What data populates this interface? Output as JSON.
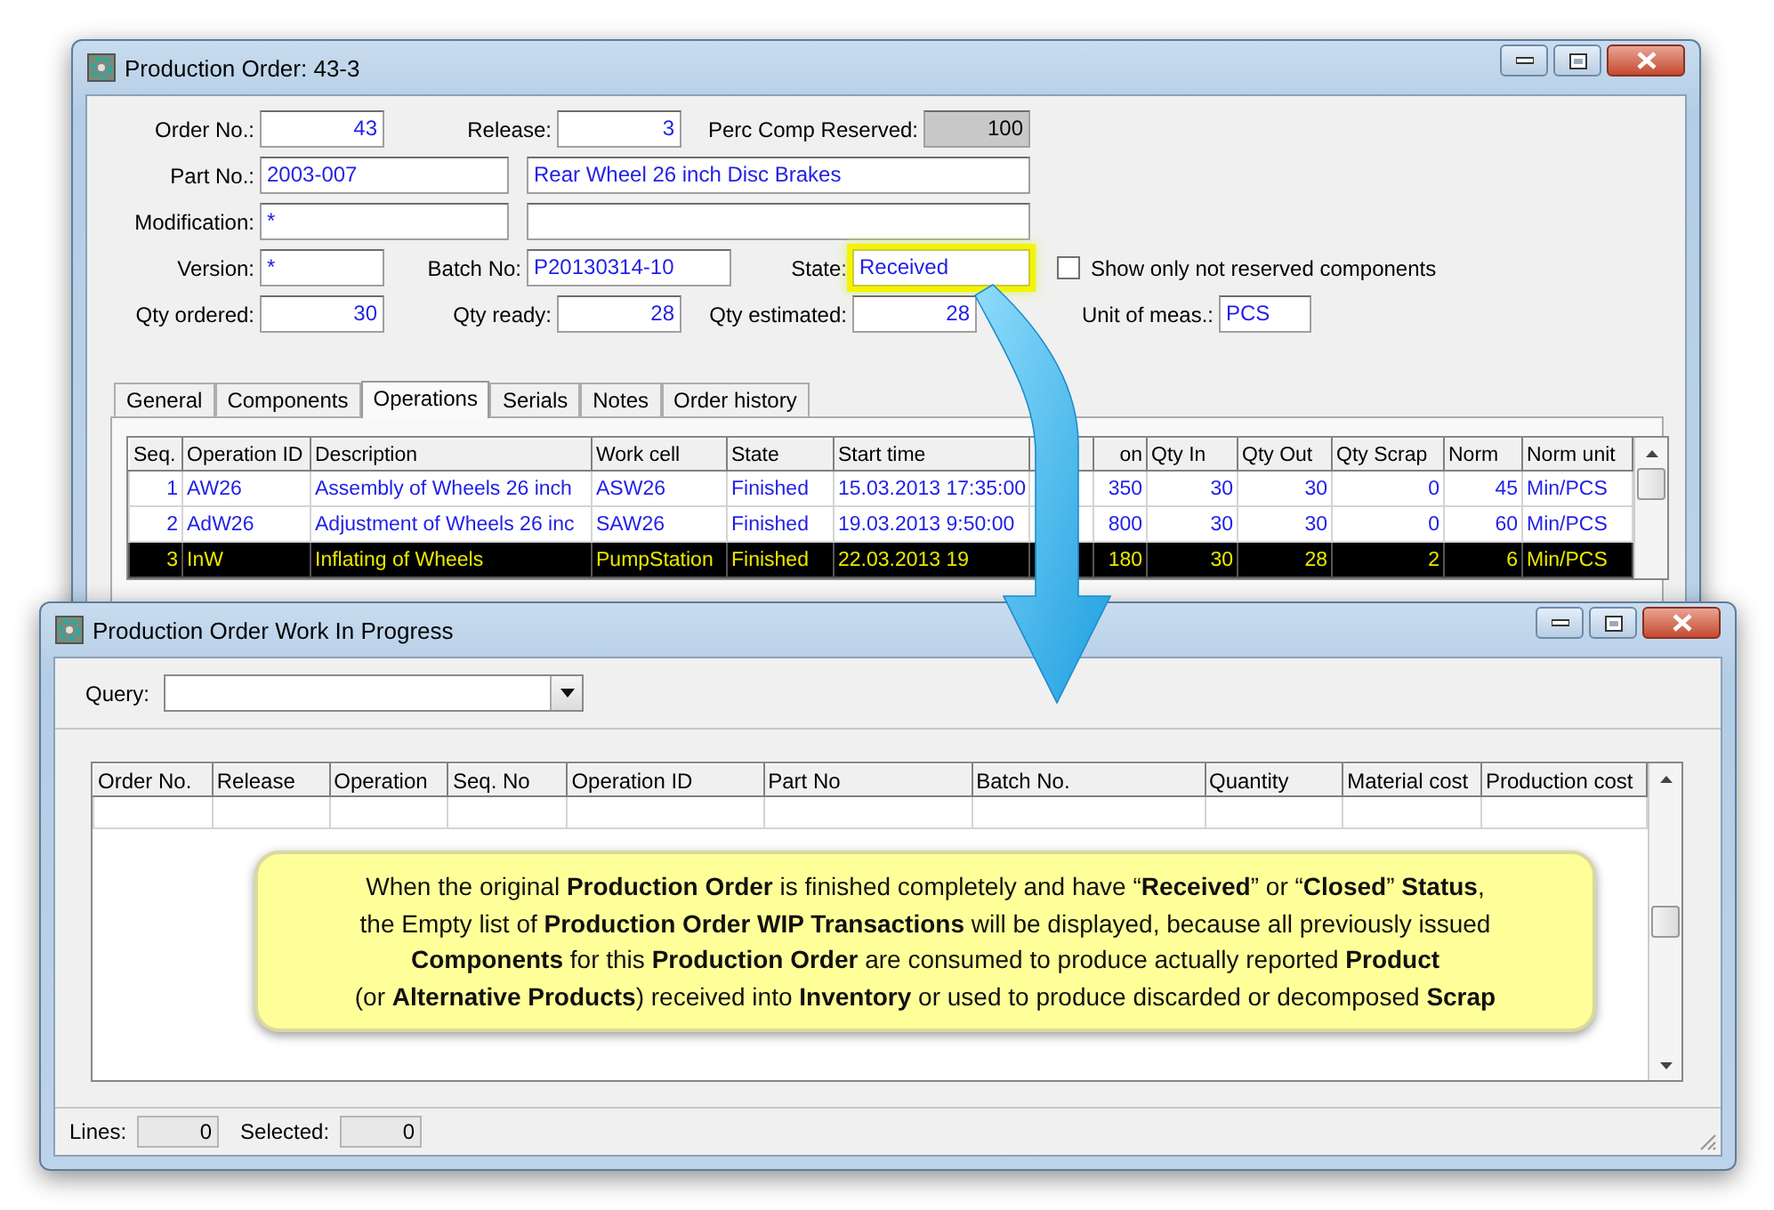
{
  "order_window": {
    "title": "Production Order: 43-3",
    "form_rows": [
      [
        {
          "kind": "label",
          "text": "Order No.:"
        },
        {
          "kind": "number_field",
          "value": "43",
          "disabled": false,
          "highlighted": false
        },
        {
          "kind": "label",
          "text": "Release:"
        },
        {
          "kind": "number_field",
          "value": "3",
          "disabled": false,
          "highlighted": false
        },
        {
          "kind": "label",
          "text": "Perc Comp Reserved:"
        },
        {
          "kind": "number_field",
          "value": "100",
          "disabled": true,
          "highlighted": false
        }
      ],
      [
        {
          "kind": "label",
          "text": "Part No.:"
        },
        {
          "kind": "text_field",
          "value": "2003-007",
          "disabled": false,
          "highlighted": false
        },
        {
          "kind": "text_field",
          "value": "Rear Wheel 26 inch Disc Brakes",
          "disabled": false,
          "highlighted": false
        }
      ],
      [
        {
          "kind": "label",
          "text": "Modification:"
        },
        {
          "kind": "text_field",
          "value": "*",
          "disabled": false,
          "highlighted": false
        },
        {
          "kind": "text_field",
          "disabled": false,
          "highlighted": false
        }
      ],
      [
        {
          "kind": "label",
          "text": "Version:"
        },
        {
          "kind": "text_field",
          "value": "*",
          "disabled": false,
          "highlighted": false
        },
        {
          "kind": "label",
          "text": "Batch No:"
        },
        {
          "kind": "text_field",
          "value": "P20130314-10",
          "disabled": false,
          "highlighted": false
        },
        {
          "kind": "label",
          "text": "State:"
        },
        {
          "kind": "text_field",
          "value": "Received",
          "disabled": false,
          "highlighted": true
        },
        {
          "kind": "checkbox",
          "label": "Show only not reserved components",
          "checked": false
        }
      ],
      [
        {
          "kind": "label",
          "text": "Qty ordered:"
        },
        {
          "kind": "number_field",
          "value": "30",
          "disabled": false,
          "highlighted": false
        },
        {
          "kind": "label",
          "text": "Qty ready:"
        },
        {
          "kind": "number_field",
          "value": "28",
          "disabled": false,
          "highlighted": false
        },
        {
          "kind": "label",
          "text": "Qty estimated:"
        },
        {
          "kind": "number_field",
          "value": "28",
          "disabled": false,
          "highlighted": false
        },
        {
          "kind": "label",
          "text": "Unit of meas.:"
        },
        {
          "kind": "text_field",
          "value": "PCS",
          "disabled": false,
          "highlighted": false
        }
      ]
    ],
    "tabs": [
      {
        "label": "General",
        "selected": false
      },
      {
        "label": "Components",
        "selected": false
      },
      {
        "label": "Operations",
        "selected": true
      },
      {
        "label": "Serials",
        "selected": false
      },
      {
        "label": "Notes",
        "selected": false
      },
      {
        "label": "Order history",
        "selected": false
      }
    ],
    "table": {
      "columns": [
        "Seq.",
        "Operation ID",
        "Description",
        "Work cell",
        "State",
        "Start time",
        "on",
        "Qty In",
        "Qty Out",
        "Qty Scrap",
        "Norm",
        "Norm unit"
      ],
      "rows": [
        {
          "selected": false,
          "cells": [
            "1",
            "AW26",
            "Assembly of Wheels 26 inch",
            "ASW26",
            "Finished",
            "15.03.2013 17:35:00",
            "350",
            "30",
            "30",
            "0",
            "45",
            "Min/PCS"
          ]
        },
        {
          "selected": false,
          "cells": [
            "2",
            "AdW26",
            "Adjustment of Wheels 26 inc",
            "SAW26",
            "Finished",
            "19.03.2013 9:50:00",
            "800",
            "30",
            "30",
            "0",
            "60",
            "Min/PCS"
          ]
        },
        {
          "selected": true,
          "cells": [
            "3",
            "InW",
            "Inflating of Wheels",
            "PumpStation",
            "Finished",
            "22.03.2013 19",
            "180",
            "30",
            "28",
            "2",
            "6",
            "Min/PCS"
          ]
        }
      ]
    }
  },
  "wip_window": {
    "title": "Production Order Work In Progress",
    "query": {
      "label": "Query:"
    },
    "table": {
      "columns": [
        "Order No.",
        "Release",
        "Operation",
        "Seq. No",
        "Operation ID",
        "Part No",
        "Batch No.",
        "Quantity",
        "Material cost",
        "Production cost"
      ]
    },
    "callout": {
      "lines": [
        "When the original **Production Order** is finished completely and have “**Received**” or “**Closed**” **Status**,",
        "the Empty list of **Production Order WIP Transactions** will be displayed, because all previously issued",
        "**Components** for this **Production Order** are consumed to produce actually reported **Product**",
        "(or **Alternative Products**) received into **Inventory** or used to produce discarded or decomposed **Scrap**"
      ]
    },
    "status_bar": [
      {
        "label": "Lines:",
        "value": "0"
      },
      {
        "label": "Selected:",
        "value": "0"
      }
    ]
  }
}
